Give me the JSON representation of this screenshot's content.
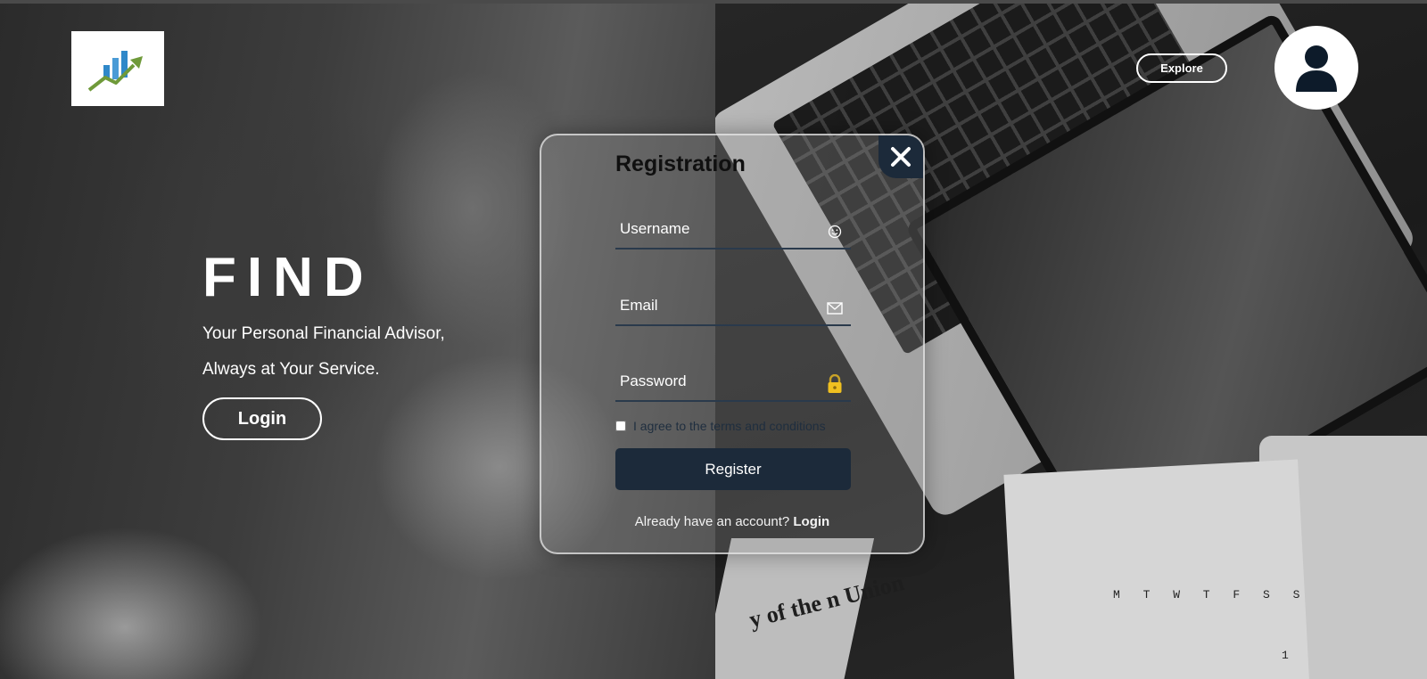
{
  "header": {
    "explore_label": "Explore"
  },
  "hero": {
    "title": "FIND",
    "line1": "Your Personal Financial Advisor,",
    "line2": "Always at Your Service.",
    "login_label": "Login"
  },
  "modal": {
    "title": "Registration",
    "username_placeholder": "Username",
    "email_placeholder": "Email",
    "password_placeholder": "Password",
    "terms_label": "I agree to the terms and conditions",
    "register_label": "Register",
    "already_text": "Already have an account?",
    "login_link": "Login"
  },
  "background": {
    "newspaper_title": "y of the n Union",
    "calendar_days": "M T W T F S S",
    "calendar_number": "1"
  },
  "icons": {
    "logo": "growth-chart-logo",
    "avatar": "user-icon",
    "close": "close-icon",
    "username": "smiley-icon",
    "email": "envelope-icon",
    "password": "lock-icon"
  },
  "colors": {
    "accent_dark": "#1c2a3a",
    "white": "#ffffff",
    "chart_blue": "#2f88c9",
    "chart_green": "#6f9a3a"
  }
}
